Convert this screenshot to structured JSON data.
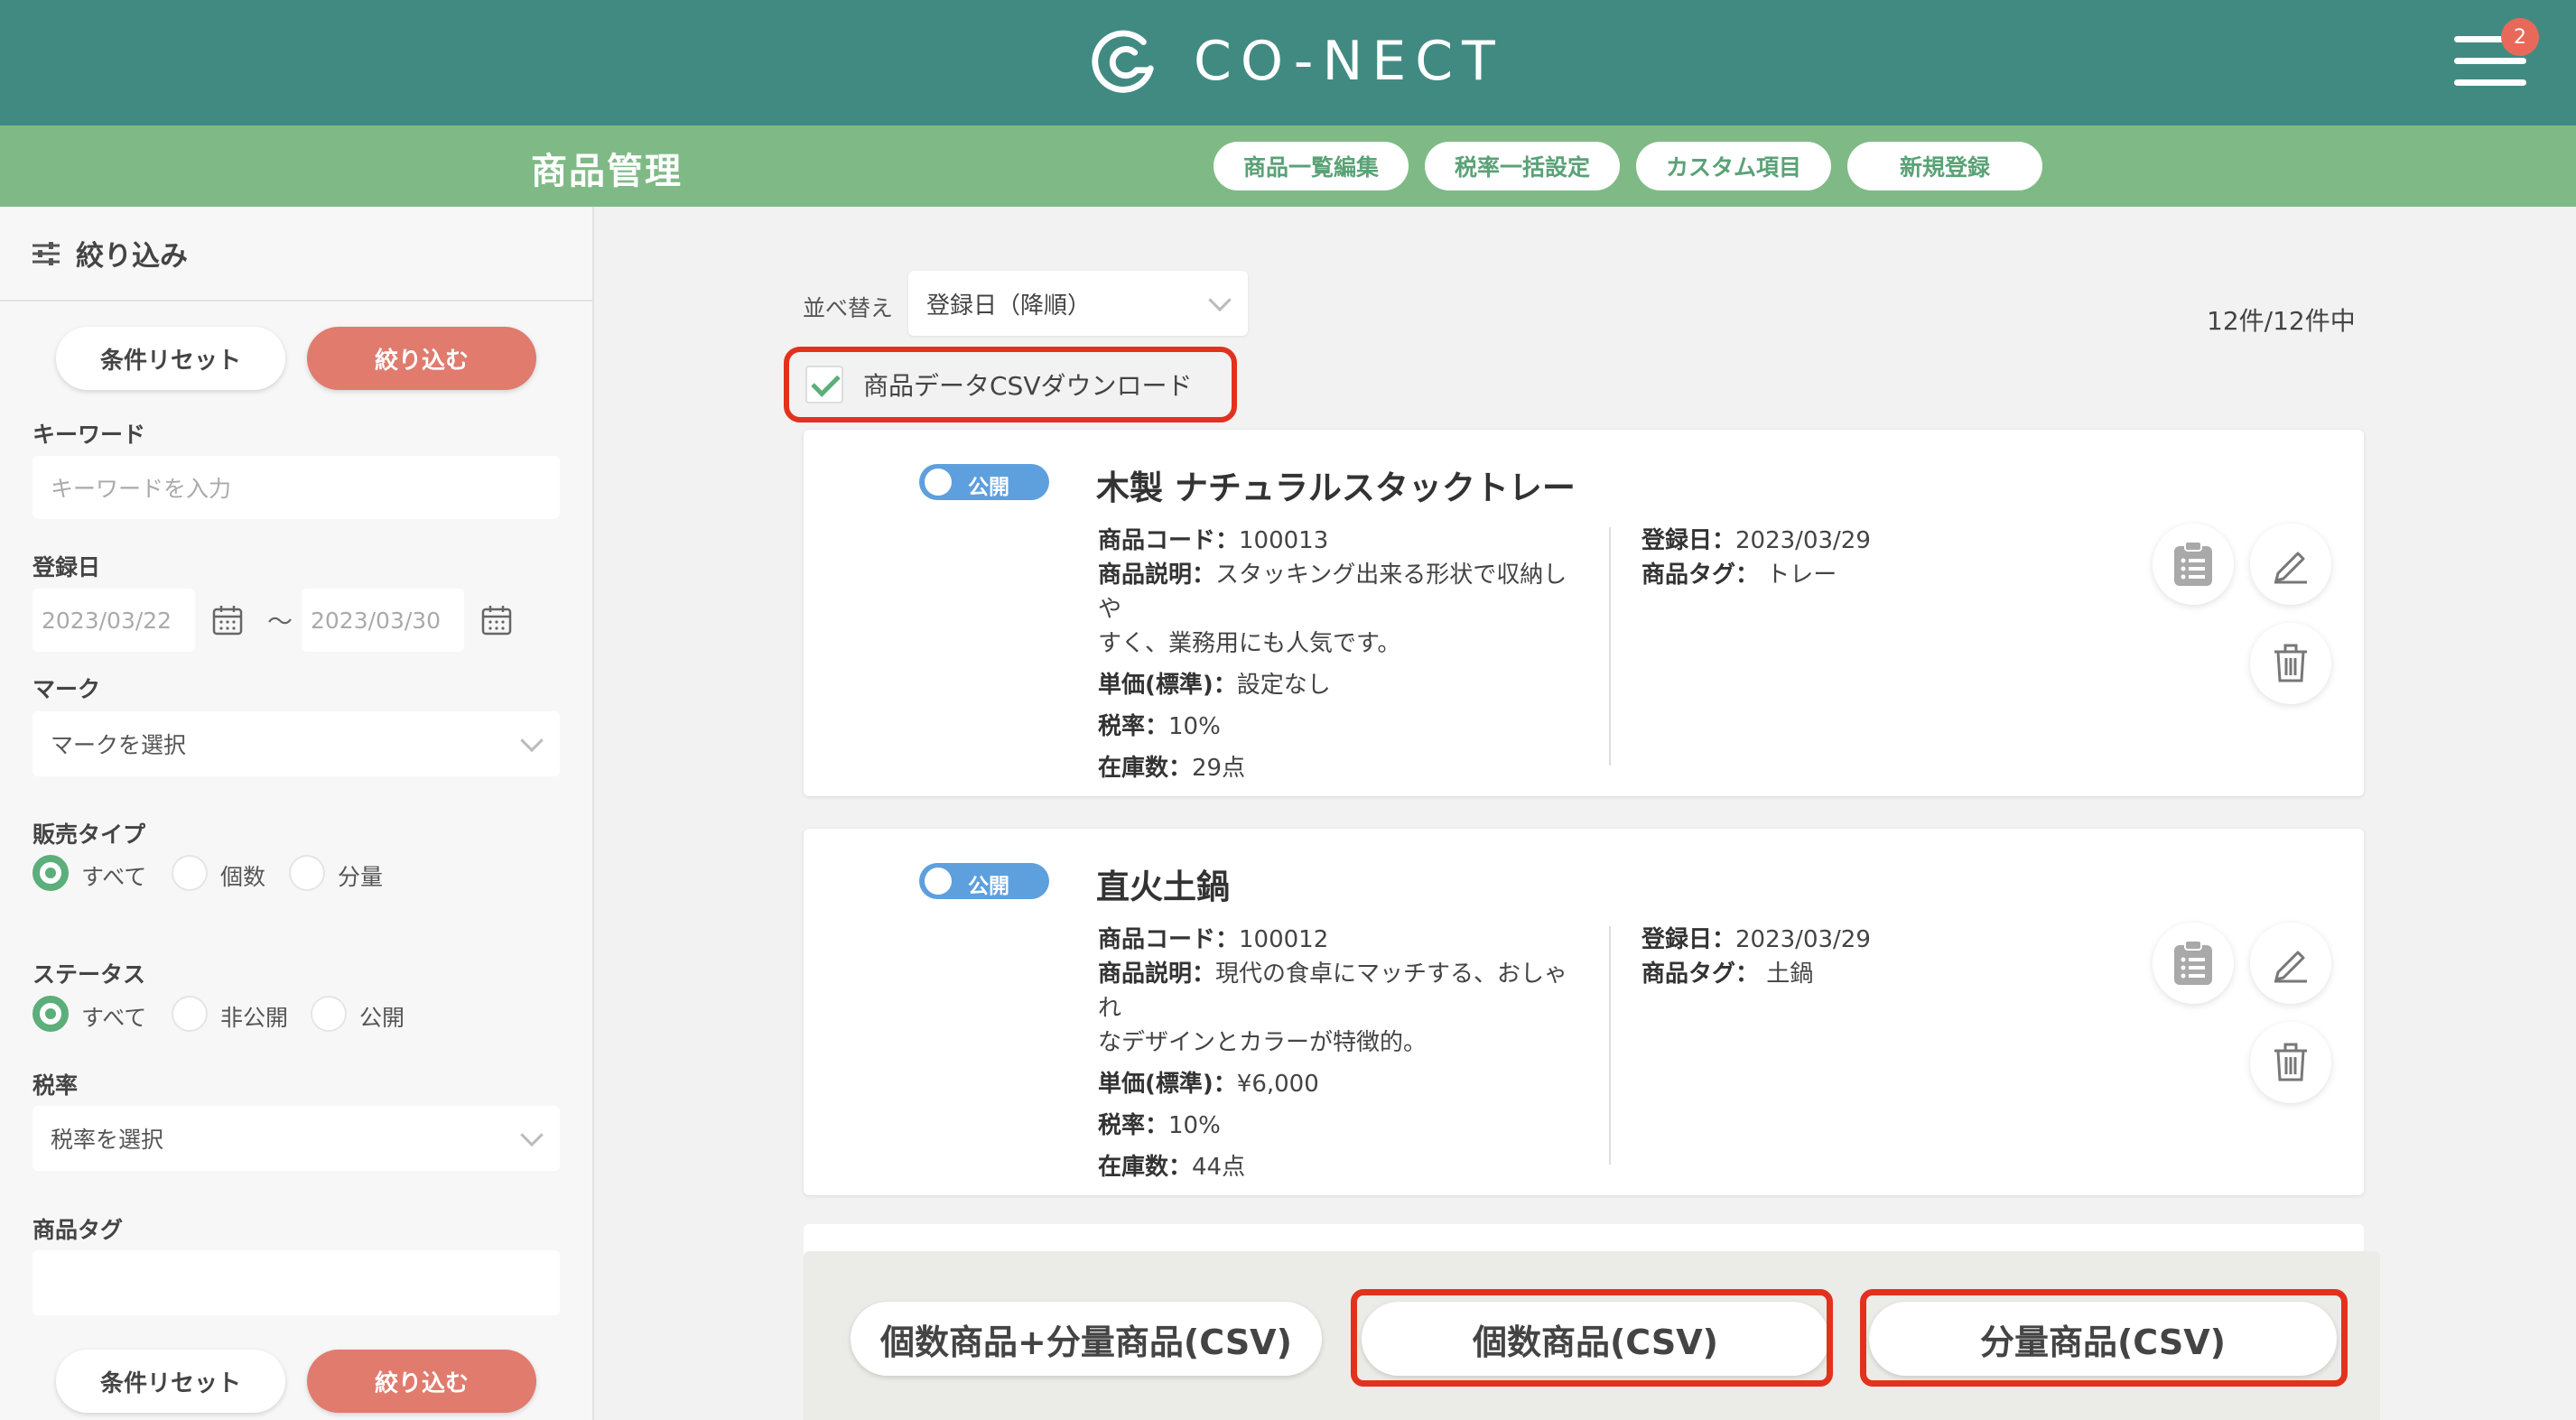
{
  "header": {
    "logo_text": "CO-NECT",
    "notification_count": "2"
  },
  "subheader": {
    "title": "商品管理",
    "actions": [
      "商品一覧編集",
      "税率一括設定",
      "カスタム項目",
      "新規登録"
    ]
  },
  "sidebar": {
    "title": "絞り込み",
    "reset_label": "条件リセット",
    "apply_label": "絞り込む",
    "keyword_label": "キーワード",
    "keyword_placeholder": "キーワードを入力",
    "date_label": "登録日",
    "date_from": "2023/03/22",
    "date_to": "2023/03/30",
    "date_sep": "〜",
    "mark_label": "マーク",
    "mark_placeholder": "マークを選択",
    "sales_type_label": "販売タイプ",
    "sales_type_options": [
      "すべて",
      "個数",
      "分量"
    ],
    "sales_type_selected": "すべて",
    "status_label": "ステータス",
    "status_options": [
      "すべて",
      "非公開",
      "公開"
    ],
    "status_selected": "すべて",
    "tax_label": "税率",
    "tax_placeholder": "税率を選択",
    "tag_label": "商品タグ",
    "tag_value": ""
  },
  "main": {
    "sort_label": "並べ替え",
    "sort_value": "登録日（降順）",
    "count_text": "12件/12件中",
    "csv_checkbox_label": "商品データCSVダウンロード",
    "csv_checkbox_checked": true,
    "products": [
      {
        "status": "公開",
        "name": "木製 ナチュラルスタックトレー",
        "code_label": "商品コード：",
        "code": "100013",
        "desc_label": "商品説明：",
        "desc_line1": "スタッキング出来る形状で収納しや",
        "desc_line2": "すく、業務用にも人気です。",
        "price_label": "単価(標準)：",
        "price": "設定なし",
        "tax_label": "税率：",
        "tax": "10%",
        "stock_label": "在庫数：",
        "stock": "29点",
        "date_label": "登録日：",
        "date": "2023/03/29",
        "tag_label": "商品タグ：",
        "tag": "トレー"
      },
      {
        "status": "公開",
        "name": "直火土鍋",
        "code_label": "商品コード：",
        "code": "100012",
        "desc_label": "商品説明：",
        "desc_line1": "現代の食卓にマッチする、おしゃれ",
        "desc_line2": "なデザインとカラーが特徴的。",
        "price_label": "単価(標準)：",
        "price": "¥6,000",
        "tax_label": "税率：",
        "tax": "10%",
        "stock_label": "在庫数：",
        "stock": "44点",
        "date_label": "登録日：",
        "date": "2023/03/29",
        "tag_label": "商品タグ：",
        "tag": "土鍋"
      }
    ],
    "csv_buttons": [
      "個数商品+分量商品(CSV)",
      "個数商品(CSV)",
      "分量商品(CSV)"
    ]
  },
  "colors": {
    "header_bg": "#418a82",
    "subheader_bg": "#7fba86",
    "apply_button": "#e07b6e",
    "toggle_on": "#5e9fdd",
    "highlight_red": "#e2321d",
    "radio_green": "#5cae7a"
  }
}
